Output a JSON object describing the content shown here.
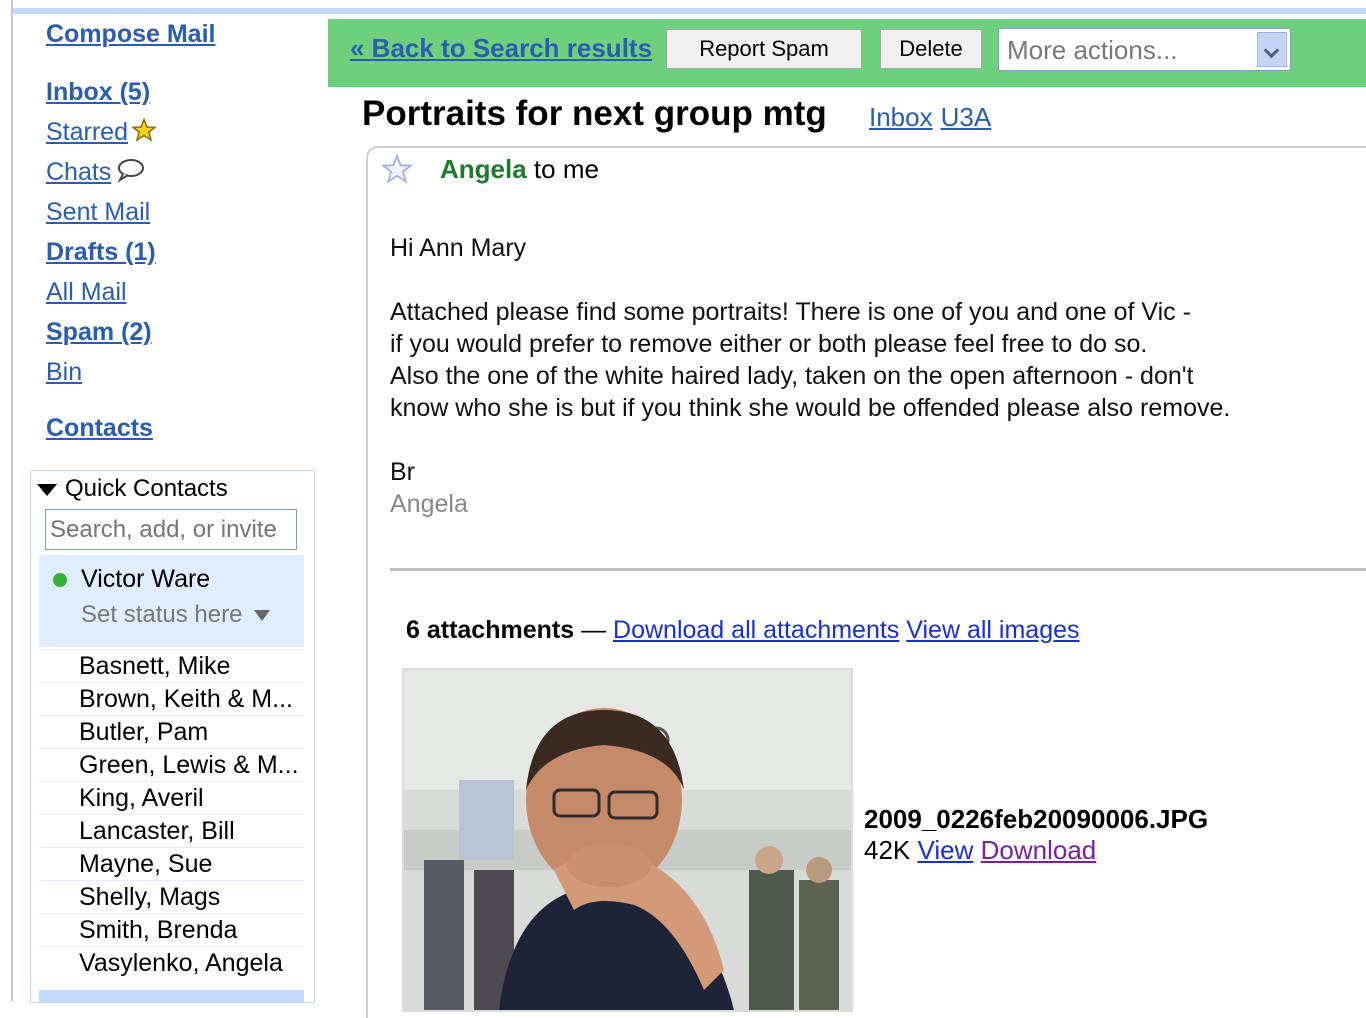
{
  "nav": {
    "compose": "Compose Mail",
    "inbox": "Inbox (5)",
    "starred": "Starred",
    "chats": "Chats",
    "sent": "Sent Mail",
    "drafts": "Drafts (1)",
    "all_mail": "All Mail",
    "spam": "Spam (2)",
    "bin": "Bin",
    "contacts": "Contacts"
  },
  "quick_contacts": {
    "title": "Quick Contacts",
    "search_placeholder": "Search, add, or invite",
    "me": {
      "name": "Victor Ware",
      "status": "Set status here"
    },
    "contacts": [
      "Basnett, Mike",
      "Brown, Keith & M...",
      "Butler, Pam",
      "Green, Lewis & M...",
      "King, Averil",
      "Lancaster, Bill",
      "Mayne, Sue",
      "Shelly, Mags",
      "Smith, Brenda",
      "Vasylenko, Angela"
    ]
  },
  "toolbar": {
    "back": "« Back to Search results",
    "report_spam": "Report Spam",
    "delete": "Delete",
    "more_actions": "More actions..."
  },
  "message": {
    "subject": "Portraits for next group mtg",
    "labels": [
      "Inbox",
      "U3A"
    ],
    "sender": "Angela",
    "recipient": "to me",
    "greeting": "Hi Ann Mary",
    "lines": [
      "Attached please find some portraits!   There is one of you and one of Vic -",
      "if you would prefer to remove either or both please feel free to do so.",
      "Also the one of the white haired lady, taken on the open afternoon - don't",
      "know who she is but if you think she would be offended please also remove."
    ],
    "signoff": "Br",
    "signature": "Angela"
  },
  "attachments": {
    "count_label": "6 attachments",
    "separator": "—",
    "download_all": "Download all attachments",
    "view_all": "View all images",
    "file": {
      "name": "2009_0226feb20090006.JPG",
      "size": "42K",
      "view": "View",
      "download": "Download"
    }
  },
  "colors": {
    "toolbar_bg": "#6ed07d",
    "link": "#2a5db0",
    "sender": "#1e7a2d",
    "online": "#34b233"
  }
}
